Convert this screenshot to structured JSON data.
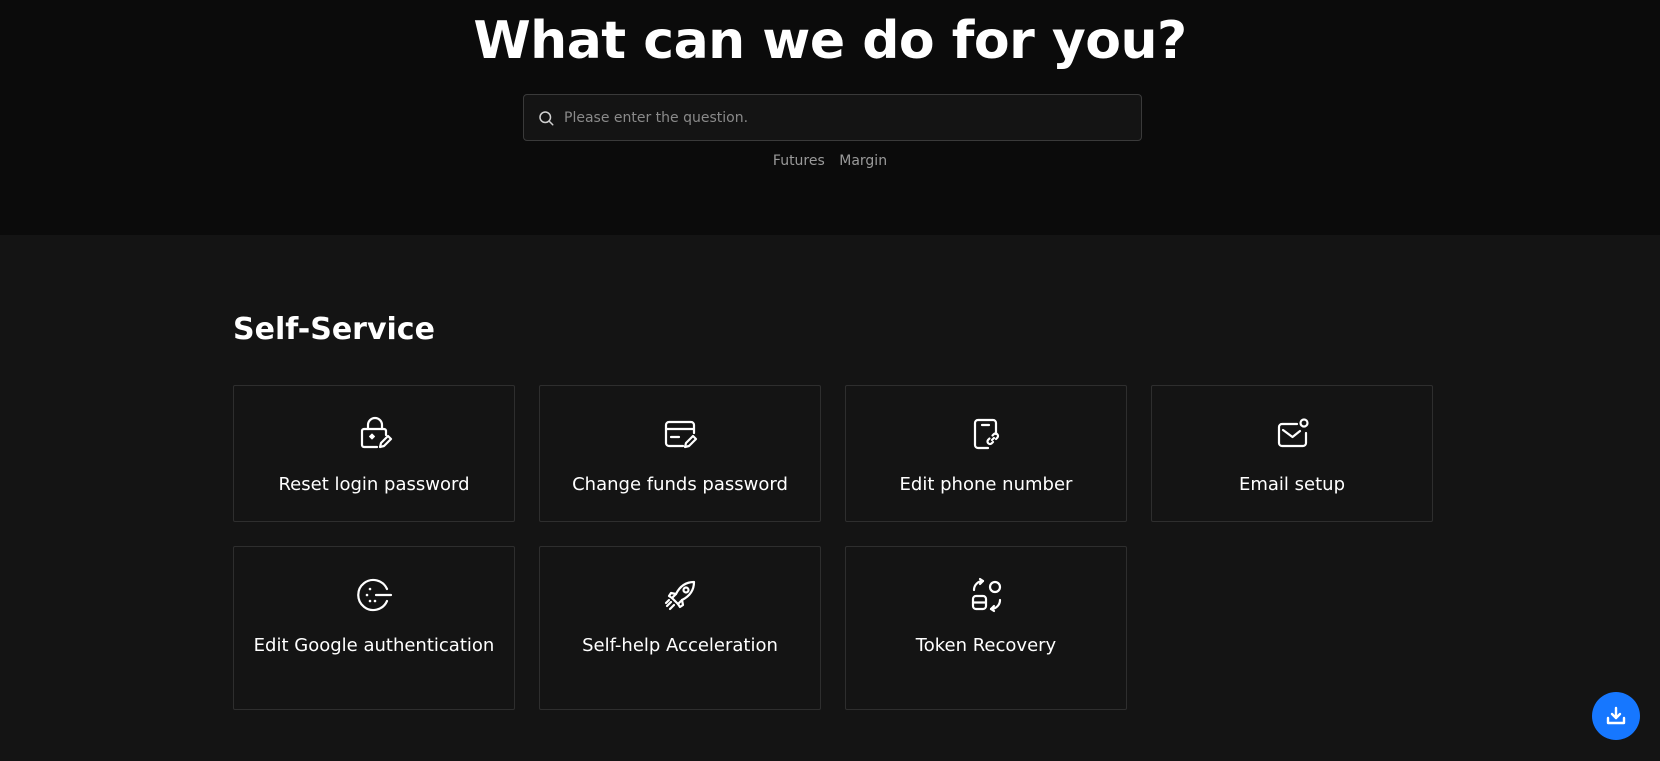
{
  "hero": {
    "title": "What can we do for you?",
    "search": {
      "placeholder": "Please enter the question.",
      "value": ""
    },
    "tags": [
      "Futures",
      "Margin"
    ]
  },
  "self_service": {
    "title": "Self-Service",
    "cards": [
      {
        "label": "Reset login password",
        "icon": "lock-edit-icon"
      },
      {
        "label": "Change funds password",
        "icon": "card-edit-icon"
      },
      {
        "label": "Edit phone number",
        "icon": "phone-link-icon"
      },
      {
        "label": "Email setup",
        "icon": "mail-notification-icon"
      },
      {
        "label": "Edit Google authentication",
        "icon": "google-auth-icon"
      },
      {
        "label": "Self-help Acceleration",
        "icon": "rocket-icon"
      },
      {
        "label": "Token Recovery",
        "icon": "token-recovery-icon"
      }
    ]
  },
  "download_button": {
    "icon": "download-icon"
  },
  "colors": {
    "hero_bg": "#0b0b0b",
    "page_bg": "#141414",
    "card_border": "#2e2e2e",
    "accent": "#1677ff"
  }
}
